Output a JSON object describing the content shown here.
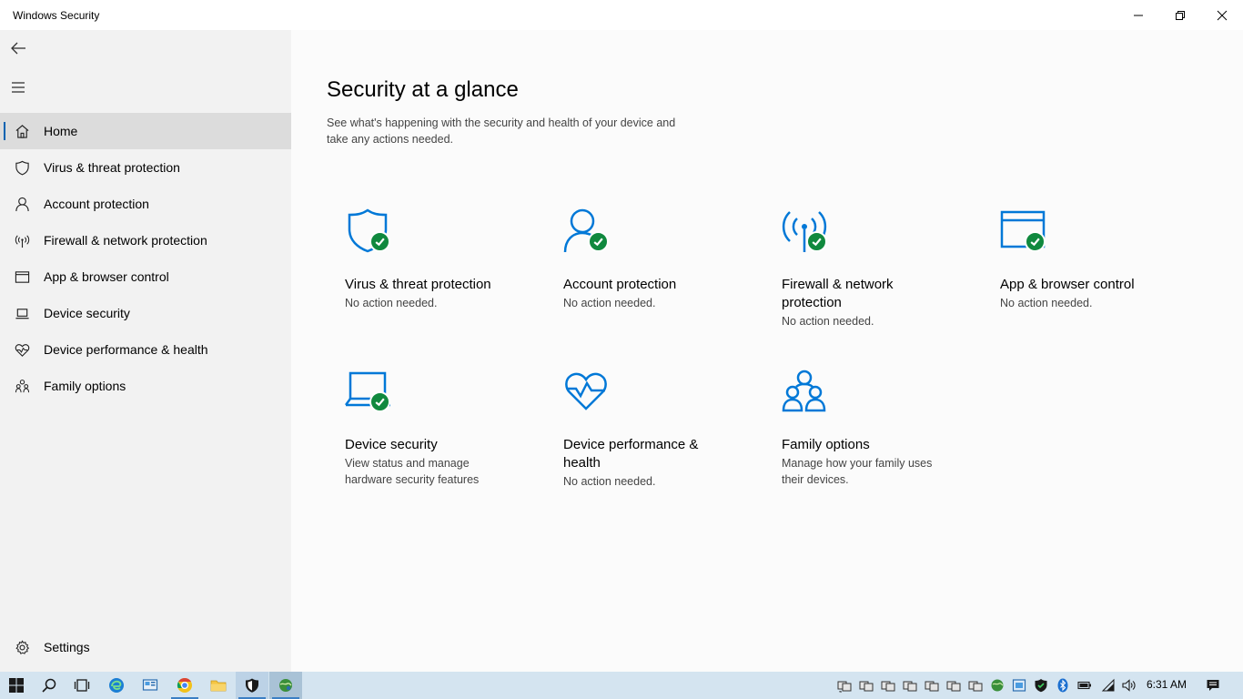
{
  "window": {
    "title": "Windows Security"
  },
  "sidebar": {
    "items": [
      {
        "label": "Home",
        "icon": "home-icon",
        "active": true
      },
      {
        "label": "Virus & threat protection",
        "icon": "shield-icon"
      },
      {
        "label": "Account protection",
        "icon": "person-icon"
      },
      {
        "label": "Firewall & network protection",
        "icon": "antenna-icon"
      },
      {
        "label": "App & browser control",
        "icon": "browser-window-icon"
      },
      {
        "label": "Device security",
        "icon": "laptop-icon"
      },
      {
        "label": "Device performance & health",
        "icon": "heart-icon"
      },
      {
        "label": "Family options",
        "icon": "family-icon"
      }
    ],
    "settings_label": "Settings"
  },
  "main": {
    "title": "Security at a glance",
    "description": "See what's happening with the security and health of your device and take any actions needed.",
    "tiles": [
      {
        "name": "Virus & threat protection",
        "status": "No action needed.",
        "icon": "shield-icon",
        "ok": true
      },
      {
        "name": "Account protection",
        "status": "No action needed.",
        "icon": "person-icon",
        "ok": true
      },
      {
        "name": "Firewall & network protection",
        "status": "No action needed.",
        "icon": "antenna-icon",
        "ok": true
      },
      {
        "name": "App & browser control",
        "status": "No action needed.",
        "icon": "browser-window-icon",
        "ok": true
      },
      {
        "name": "Device security",
        "status": "View status and manage hardware security features",
        "icon": "laptop-icon",
        "ok": true
      },
      {
        "name": "Device performance & health",
        "status": "No action needed.",
        "icon": "heart-icon",
        "ok": false
      },
      {
        "name": "Family options",
        "status": "Manage how your family uses their devices.",
        "icon": "family-icon",
        "ok": false
      }
    ]
  },
  "taskbar": {
    "clock": "6:31 AM"
  },
  "colors": {
    "accent": "#0078d7",
    "ok_green": "#10893e",
    "sidebar_bg": "#f2f2f2",
    "taskbar_bg": "#d4e4f0"
  }
}
